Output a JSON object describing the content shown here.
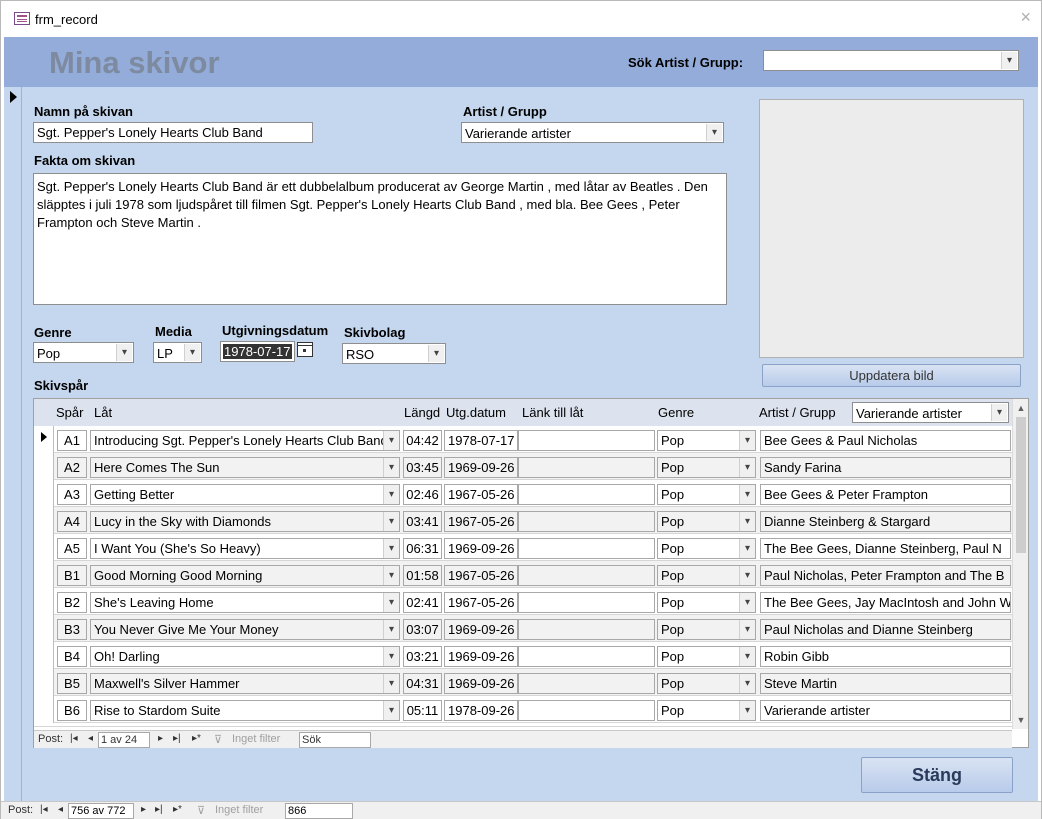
{
  "window": {
    "title": "frm_record",
    "close_glyph": "×"
  },
  "header": {
    "app_title": "Mina skivor",
    "search_label": "Sök Artist / Grupp:",
    "search_value": ""
  },
  "record": {
    "name_label": "Namn på skivan",
    "name_value": "Sgt. Pepper's Lonely Hearts Club Band",
    "artist_label": "Artist / Grupp",
    "artist_value": "Varierande artister",
    "facts_label": "Fakta om skivan",
    "facts_value": "Sgt. Pepper's Lonely Hearts Club Band är ett dubbelalbum producerat av George Martin ,  med låtar av Beatles . Den släpptes i juli 1978 som ljudspåret till filmen Sgt. Pepper's Lonely Hearts Club Band , med bla. Bee Gees , Peter Frampton och Steve Martin .",
    "genre_label": "Genre",
    "genre_value": "Pop",
    "media_label": "Media",
    "media_value": "LP",
    "date_label": "Utgivningsdatum",
    "date_value": "1978-07-17",
    "label_label": "Skivbolag",
    "label_value": "RSO",
    "update_image_button": "Uppdatera bild",
    "tracks_label": "Skivspår"
  },
  "tracks": {
    "headers": {
      "spar": "Spår",
      "lat": "Låt",
      "langd": "Längd",
      "utgdatum": "Utg.datum",
      "lank": "Länk till låt",
      "genre": "Genre",
      "artist": "Artist / Grupp",
      "artist_filter": "Varierande artister"
    },
    "rows": [
      {
        "spar": "A1",
        "lat": "Introducing Sgt. Pepper's Lonely Hearts Club Band",
        "langd": "04:42",
        "datum": "1978-07-17",
        "lank": "",
        "genre": "Pop",
        "artist": "Bee Gees & Paul Nicholas"
      },
      {
        "spar": "A2",
        "lat": "Here Comes The Sun",
        "langd": "03:45",
        "datum": "1969-09-26",
        "lank": "",
        "genre": "Pop",
        "artist": "Sandy Farina"
      },
      {
        "spar": "A3",
        "lat": "Getting Better",
        "langd": "02:46",
        "datum": "1967-05-26",
        "lank": "",
        "genre": "Pop",
        "artist": "Bee Gees & Peter Frampton"
      },
      {
        "spar": "A4",
        "lat": "Lucy in the Sky with Diamonds",
        "langd": "03:41",
        "datum": "1967-05-26",
        "lank": "",
        "genre": "Pop",
        "artist": "Dianne Steinberg & Stargard"
      },
      {
        "spar": "A5",
        "lat": "I Want You (She's So Heavy)",
        "langd": "06:31",
        "datum": "1969-09-26",
        "lank": "",
        "genre": "Pop",
        "artist": "The Bee Gees, Dianne Steinberg, Paul N"
      },
      {
        "spar": "B1",
        "lat": "Good Morning Good Morning",
        "langd": "01:58",
        "datum": "1967-05-26",
        "lank": "",
        "genre": "Pop",
        "artist": "Paul Nicholas, Peter Frampton and The B"
      },
      {
        "spar": "B2",
        "lat": "She's Leaving Home",
        "langd": "02:41",
        "datum": "1967-05-26",
        "lank": "",
        "genre": "Pop",
        "artist": "The Bee Gees, Jay MacIntosh and John W"
      },
      {
        "spar": "B3",
        "lat": "You Never Give Me Your Money",
        "langd": "03:07",
        "datum": "1969-09-26",
        "lank": "",
        "genre": "Pop",
        "artist": "Paul Nicholas and Dianne Steinberg"
      },
      {
        "spar": "B4",
        "lat": "Oh! Darling",
        "langd": "03:21",
        "datum": "1969-09-26",
        "lank": "",
        "genre": "Pop",
        "artist": "Robin Gibb"
      },
      {
        "spar": "B5",
        "lat": "Maxwell's Silver Hammer",
        "langd": "04:31",
        "datum": "1969-09-26",
        "lank": "",
        "genre": "Pop",
        "artist": "Steve Martin"
      },
      {
        "spar": "B6",
        "lat": "Rise to Stardom Suite",
        "langd": "05:11",
        "datum": "1978-09-26",
        "lank": "",
        "genre": "Pop",
        "artist": "Varierande artister"
      }
    ]
  },
  "subnav": {
    "post_label": "Post:",
    "position": "1 av 24",
    "filter_label": "Inget filter",
    "search_value": "Sök"
  },
  "close_button": "Stäng",
  "mainnav": {
    "post_label": "Post:",
    "position": "756 av 772",
    "filter_label": "Inget filter",
    "search_value": "866"
  },
  "colors": {
    "header_bg": "#93acd9",
    "body_bg": "#c5d7ee",
    "title_color": "#7d8aa0"
  }
}
